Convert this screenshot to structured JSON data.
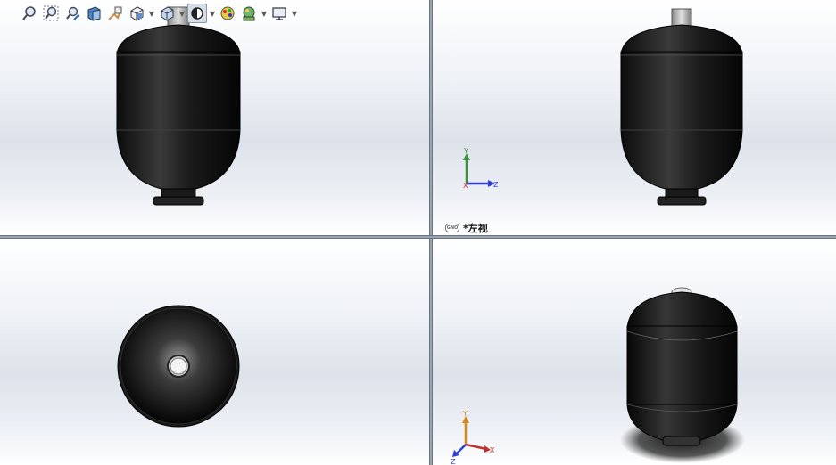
{
  "toolbar": {
    "items": [
      {
        "name": "zoom-to-fit-icon"
      },
      {
        "name": "zoom-to-area-icon"
      },
      {
        "name": "previous-view-icon"
      },
      {
        "name": "section-view-icon"
      },
      {
        "name": "dynamic-annotation-icon"
      },
      {
        "name": "view-orientation-icon"
      },
      {
        "name": "display-style-icon"
      },
      {
        "name": "hide-show-items-icon"
      },
      {
        "name": "edit-appearance-icon"
      },
      {
        "name": "apply-scene-icon"
      },
      {
        "name": "view-settings-icon"
      }
    ]
  },
  "viewports": {
    "top_right": {
      "label": "*左视",
      "tag": "GNO"
    }
  },
  "triads": {
    "left_view": {
      "up": "Y",
      "right": "Z",
      "center": "X"
    },
    "iso_view": {
      "up": "Y",
      "right": "X",
      "left": "Z"
    }
  },
  "colors": {
    "background_top": "#ffffff",
    "background_mid": "#dde2ea",
    "model_body": "#141414",
    "y_axis": "#3b8f3b",
    "z_axis": "#2f3fd1",
    "x_axis": "#c03030"
  }
}
